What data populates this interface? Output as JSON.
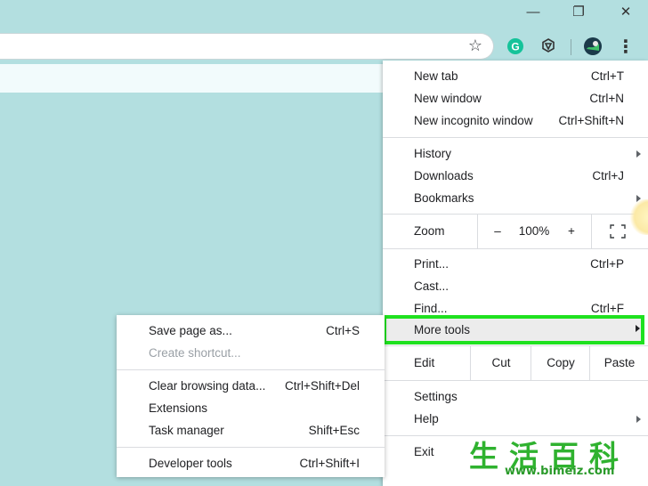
{
  "window": {
    "minimize_glyph": "—",
    "restore_glyph": "❐",
    "close_glyph": "✕"
  },
  "toolbar": {
    "star_icon": "bookmark-star-icon",
    "extensions": [
      {
        "name": "grammarly-extension-icon",
        "letter": "G",
        "color": "#15c39a"
      },
      {
        "name": "openai-extension-icon",
        "color": "#333333"
      }
    ],
    "menu_glyph": "⋮"
  },
  "menu": {
    "new_tab": {
      "label": "New tab",
      "shortcut": "Ctrl+T"
    },
    "new_window": {
      "label": "New window",
      "shortcut": "Ctrl+N"
    },
    "new_incognito": {
      "label": "New incognito window",
      "shortcut": "Ctrl+Shift+N"
    },
    "history": {
      "label": "History"
    },
    "downloads": {
      "label": "Downloads",
      "shortcut": "Ctrl+J"
    },
    "bookmarks": {
      "label": "Bookmarks"
    },
    "zoom": {
      "label": "Zoom",
      "minus": "–",
      "value": "100%",
      "plus": "+"
    },
    "print": {
      "label": "Print...",
      "shortcut": "Ctrl+P"
    },
    "cast": {
      "label": "Cast..."
    },
    "find": {
      "label": "Find...",
      "shortcut": "Ctrl+F"
    },
    "more_tools": {
      "label": "More tools"
    },
    "edit": {
      "label": "Edit",
      "cut": "Cut",
      "copy": "Copy",
      "paste": "Paste"
    },
    "settings": {
      "label": "Settings"
    },
    "help": {
      "label": "Help"
    },
    "exit": {
      "label": "Exit"
    }
  },
  "submenu": {
    "save_page": {
      "label": "Save page as...",
      "shortcut": "Ctrl+S"
    },
    "create_shortcut": {
      "label": "Create shortcut..."
    },
    "clear_data": {
      "label": "Clear browsing data...",
      "shortcut": "Ctrl+Shift+Del"
    },
    "extensions": {
      "label": "Extensions"
    },
    "task_manager": {
      "label": "Task manager",
      "shortcut": "Shift+Esc"
    },
    "developer_tools": {
      "label": "Developer tools",
      "shortcut": "Ctrl+Shift+I"
    }
  },
  "colors": {
    "background": "#b3dfe0",
    "highlight_border": "#1fe11f",
    "watermark": "#2fb22f"
  },
  "watermark": {
    "chinese": "生活百科",
    "url": "www.bimeiz.com"
  }
}
